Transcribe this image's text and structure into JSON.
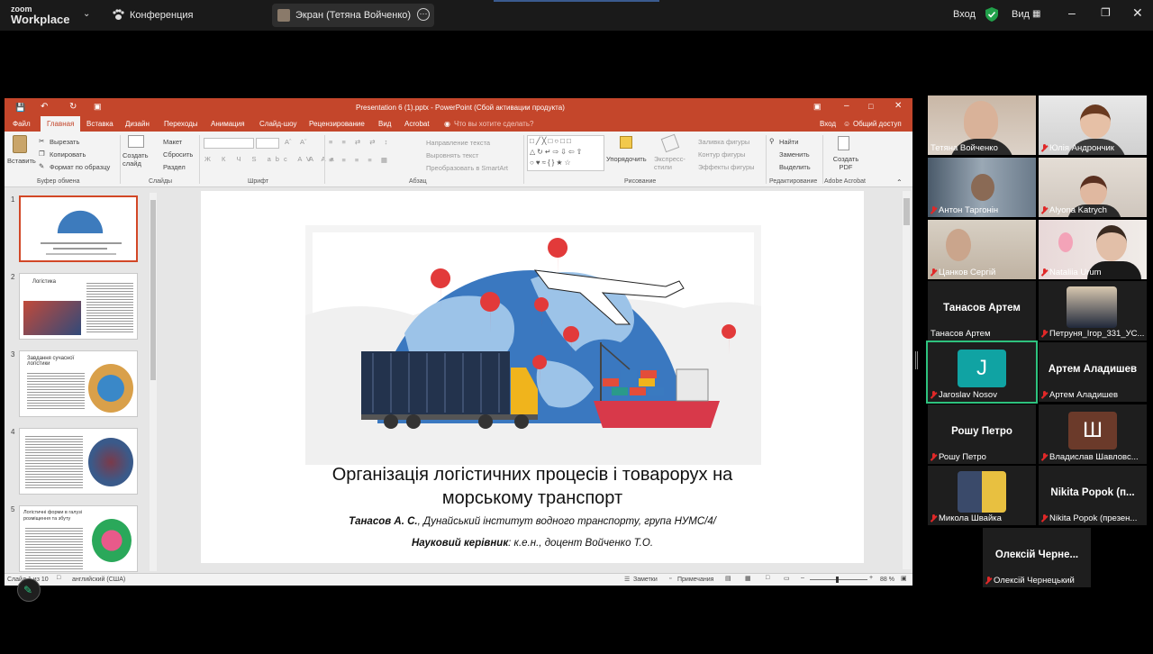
{
  "zoom": {
    "logo_small": "zoom",
    "logo_big": "Workplace",
    "conference_label": "Конференция",
    "share_label": "Экран (Тетяна Войченко)",
    "enter_label": "Вход",
    "view_label": "Вид"
  },
  "ppt": {
    "window_title": "Presentation 6 (1).pptx - PowerPoint (Сбой активации продукта)",
    "tabs": [
      "Файл",
      "Главная",
      "Вставка",
      "Дизайн",
      "Переходы",
      "Анимация",
      "Слайд-шоу",
      "Рецензирование",
      "Вид",
      "Acrobat"
    ],
    "tell_me": "Что вы хотите сделать?",
    "signin": "Вход",
    "share": "Общий доступ",
    "ribbon": {
      "paste": "Вставить",
      "cut": "Вырезать",
      "copy": "Копировать",
      "format_painter": "Формат по образцу",
      "clipboard_group": "Буфер обмена",
      "new_slide": "Создать слайд",
      "layout": "Макет",
      "reset": "Сбросить",
      "section": "Раздел",
      "slides_group": "Слайды",
      "font_group": "Шрифт",
      "text_direction": "Направление текста",
      "align_text": "Выровнять текст",
      "smartart": "Преобразовать в SmartArt",
      "paragraph_group": "Абзац",
      "arrange": "Упорядочить",
      "quick_styles": "Экспресс-стили",
      "shape_fill": "Заливка фигуры",
      "shape_outline": "Контур фигуры",
      "shape_effects": "Эффекты фигуры",
      "drawing_group": "Рисование",
      "find": "Найти",
      "replace": "Заменить",
      "select": "Выделить",
      "editing_group": "Редактирование",
      "create_pdf": "Создать PDF",
      "acrobat_group": "Adobe Acrobat"
    },
    "thumbnails": [
      {
        "num": "1"
      },
      {
        "num": "2",
        "title": "Логістика"
      },
      {
        "num": "3",
        "title": "Завдання сучасної логістики"
      },
      {
        "num": "4"
      },
      {
        "num": "5",
        "title": "Логістичні форми в галузі розміщення та збуту"
      }
    ],
    "slide": {
      "title_line1": "Організація логістичних процесів і товарорух на",
      "title_line2": "морському транспорт",
      "author_name": "Танасов А. С.",
      "author_rest": ", Дунайський інститут водного транспорту, група НУМС/4/",
      "advisor_label": "Науковий керівник",
      "advisor_rest": ": к.е.н., доцент Войченко Т.О."
    },
    "status": {
      "slide_counter": "Слайд 1 из 10",
      "language": "английский (США)",
      "notes": "Заметки",
      "comments": "Примечания",
      "zoom": "88 %"
    }
  },
  "participants": [
    {
      "name": "Тетяна Войченко",
      "muted": false
    },
    {
      "name": "Юлія Андрончик",
      "muted": true
    },
    {
      "name": "Антон Таргонін",
      "muted": true
    },
    {
      "name": "Alyona Katrych",
      "muted": true
    },
    {
      "name": "Цанков Сергій",
      "muted": true
    },
    {
      "name": "Nataliia Urum",
      "muted": true
    },
    {
      "name": "Танасов Артем",
      "big": "Танасов Артем",
      "muted": false
    },
    {
      "name": "Петруня_Ігор_331_УС...",
      "muted": true
    },
    {
      "name": "Jaroslav Nosov",
      "avatar": "J",
      "muted": true
    },
    {
      "name": "Артем Аладишев",
      "big": "Артем Аладишев",
      "muted": true
    },
    {
      "name": "Рошу Петро",
      "big": "Рошу Петро",
      "muted": true
    },
    {
      "name": "Владислав Шавловс...",
      "avatar": "Ш",
      "muted": true
    },
    {
      "name": "Микола Швайка",
      "muted": true
    },
    {
      "name": "Nikita Popok (презен...",
      "big": "Nikita Popok (п...",
      "muted": true
    },
    {
      "name": "Олексій Чернецький",
      "big": "Олексій Черне...",
      "muted": true
    }
  ]
}
